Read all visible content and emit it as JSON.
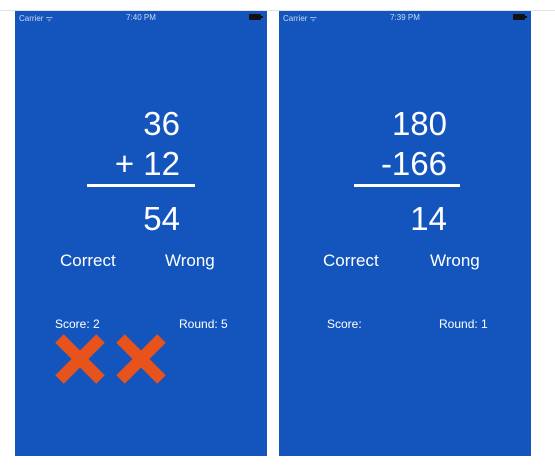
{
  "left_screen": {
    "status": {
      "carrier": "Carrier ᯤ",
      "time": "7:40 PM",
      "battery_icon": "battery-icon"
    },
    "problem": {
      "top": "36",
      "bottom": "+ 12",
      "answer": "54"
    },
    "buttons": {
      "correct": "Correct",
      "wrong": "Wrong"
    },
    "score_label": "Score: 2",
    "round_label": "Round: 5",
    "marks": [
      "wrong-x-icon",
      "wrong-x-icon"
    ]
  },
  "right_screen": {
    "status": {
      "carrier": "Carrier ᯤ",
      "time": "7:39 PM",
      "battery_icon": "battery-icon"
    },
    "problem": {
      "top": "180",
      "bottom": "-166",
      "answer": "14"
    },
    "buttons": {
      "correct": "Correct",
      "wrong": "Wrong"
    },
    "score_label": "Score:",
    "round_label": "Round: 1"
  },
  "colors": {
    "background": "#1455bd",
    "text": "#ffffff",
    "wrong_mark": "#e8521b"
  }
}
